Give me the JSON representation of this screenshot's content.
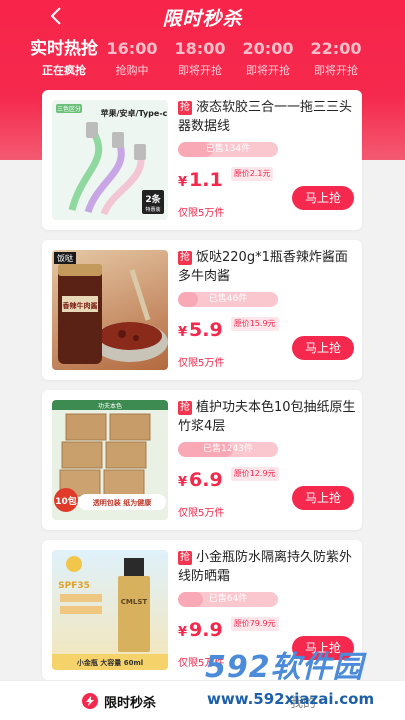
{
  "header": {
    "title": "限时秒杀",
    "tabs": [
      {
        "time": "实时热抢",
        "state": "正在疯抢",
        "active": true
      },
      {
        "time": "16:00",
        "state": "抢购中",
        "active": false
      },
      {
        "time": "18:00",
        "state": "即将开抢",
        "active": false
      },
      {
        "time": "20:00",
        "state": "即将开抢",
        "active": false
      },
      {
        "time": "22:00",
        "state": "即将开抢",
        "active": false
      }
    ]
  },
  "qiang_badge": "抢",
  "yen": "¥",
  "products": [
    {
      "title": "液态软胶三合一一拖三三头器数据线",
      "sold": "已售134件",
      "sold_fraction": 0.35,
      "price": "1.1",
      "original": "原价2.1元",
      "limit": "仅限5万件",
      "buy": "马上抢",
      "img_text": [
        "三色区分",
        "苹果/安卓/Type-c",
        "2条",
        "特惠装"
      ]
    },
    {
      "title": "饭哒220g*1瓶香辣炸酱面多牛肉酱",
      "sold": "已售46件",
      "sold_fraction": 0.2,
      "price": "5.9",
      "original": "原价15.9元",
      "limit": "仅限5万件",
      "buy": "马上抢",
      "img_text": [
        "饭哒",
        "香辣牛肉酱"
      ]
    },
    {
      "title": "植护功夫本色10包抽纸原生竹浆4层",
      "sold": "已售1243件",
      "sold_fraction": 0.55,
      "price": "6.9",
      "original": "原价12.9元",
      "limit": "仅限5万件",
      "buy": "马上抢",
      "img_text": [
        "功夫本色",
        "10包",
        "透明包装 纸为健康"
      ]
    },
    {
      "title": "小金瓶防水隔离持久防紫外线防晒霜",
      "sold": "已售64件",
      "sold_fraction": 0.25,
      "price": "9.9",
      "original": "原价79.9元",
      "limit": "仅限5万件",
      "buy": "马上抢",
      "img_text": [
        "SPF35",
        "小金瓶 大容量 60ml",
        "CMLST"
      ]
    }
  ],
  "bottom_nav": {
    "flash": "限时秒杀",
    "other": "我的"
  },
  "watermark": {
    "brand": "592软件园",
    "url": "www.592xiazai.com"
  },
  "colors": {
    "accent": "#f5294d",
    "background": "#f2f2f2"
  }
}
